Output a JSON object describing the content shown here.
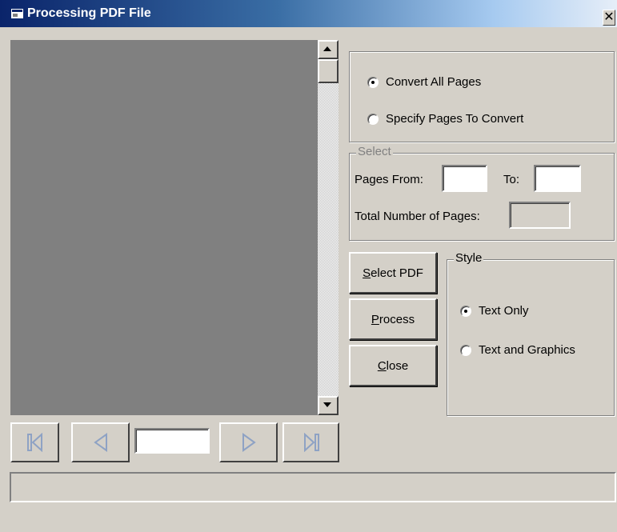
{
  "window": {
    "title": "Processing PDF File",
    "close_glyph": "✕"
  },
  "preview": {
    "page_number": ""
  },
  "pages_mode": {
    "convert_all_label": "Convert All Pages",
    "specify_label": "Specify Pages To Convert",
    "selected": "convert_all"
  },
  "select_group": {
    "legend": "Select",
    "from_label": "Pages From:",
    "from_value": "",
    "to_label": "To:",
    "to_value": "",
    "total_label": "Total Number of Pages:",
    "total_value": ""
  },
  "buttons": {
    "select_pdf": {
      "mnemonic": "S",
      "rest": "elect PDF"
    },
    "process": {
      "mnemonic": "P",
      "rest": "rocess"
    },
    "close": {
      "mnemonic": "C",
      "rest": "lose"
    }
  },
  "style_group": {
    "legend": "Style",
    "text_only_label": "Text Only",
    "text_graphics_label": "Text and Graphics",
    "selected": "text_only"
  },
  "status": {
    "text": ""
  },
  "icons": {
    "first": "first-page-icon",
    "prev": "previous-page-icon",
    "next": "next-page-icon",
    "last": "last-page-icon"
  },
  "colors": {
    "titlebar_start": "#0a246a",
    "titlebar_end": "#a6caf0",
    "face": "#d4d0c8",
    "preview_bg": "#808080",
    "nav_icon": "#8ea2c4"
  }
}
